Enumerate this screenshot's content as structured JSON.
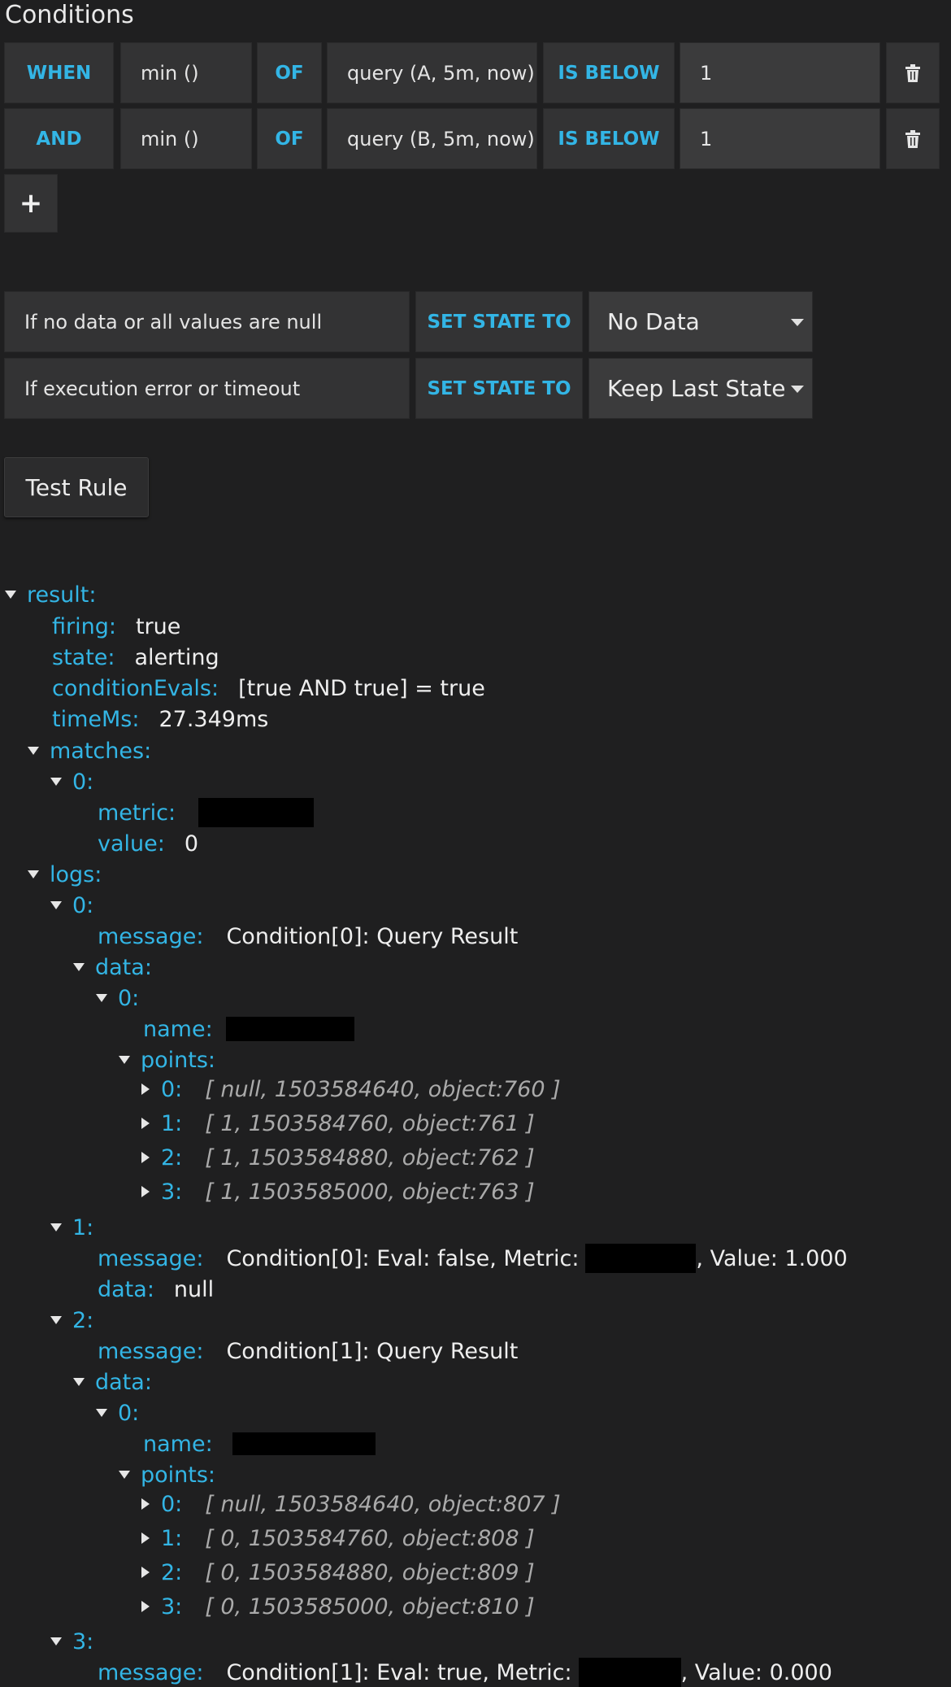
{
  "header": {
    "title": "Conditions"
  },
  "conditions": [
    {
      "type": "WHEN",
      "reducer": "min ()",
      "of": "OF",
      "query": "query (A, 5m, now)",
      "evaluator": "IS BELOW",
      "threshold": "1"
    },
    {
      "type": "AND",
      "reducer": "min ()",
      "of": "OF",
      "query": "query (B, 5m, now)",
      "evaluator": "IS BELOW",
      "threshold": "1"
    }
  ],
  "add_label": "+",
  "no_data": {
    "label": "If no data or all values are null",
    "action": "SET STATE TO",
    "selected": "No Data"
  },
  "exec_error": {
    "label": "If execution error or timeout",
    "action": "SET STATE TO",
    "selected": "Keep Last State"
  },
  "test_rule_label": "Test Rule",
  "result": {
    "key": "result:",
    "firing": {
      "key": "firing:",
      "value": "true"
    },
    "state": {
      "key": "state:",
      "value": "alerting"
    },
    "conditionEvals": {
      "key": "conditionEvals:",
      "value": "[true AND true] = true"
    },
    "timeMs": {
      "key": "timeMs:",
      "value": "27.349ms"
    },
    "matches": {
      "key": "matches:",
      "item0": {
        "key": "0:",
        "metric_key": "metric:",
        "value_key": "value:",
        "value": "0"
      }
    },
    "logs": {
      "key": "logs:",
      "log0": {
        "key": "0:",
        "message_key": "message:",
        "message": "Condition[0]: Query Result",
        "data_key": "data:",
        "d0": "0:",
        "name_key": "name:",
        "points_key": "points:",
        "points": [
          {
            "k": "0:",
            "v": "[ null, 1503584640, object:760 ]"
          },
          {
            "k": "1:",
            "v": "[ 1, 1503584760, object:761 ]"
          },
          {
            "k": "2:",
            "v": "[ 1, 1503584880, object:762 ]"
          },
          {
            "k": "3:",
            "v": "[ 1, 1503585000, object:763 ]"
          }
        ]
      },
      "log1": {
        "key": "1:",
        "message_key": "message:",
        "message_pre": "Condition[0]: Eval: false, Metric:",
        "message_post": ", Value: 1.000",
        "data_key": "data:",
        "data_value": "null"
      },
      "log2": {
        "key": "2:",
        "message_key": "message:",
        "message": "Condition[1]: Query Result",
        "data_key": "data:",
        "d0": "0:",
        "name_key": "name:",
        "points_key": "points:",
        "points": [
          {
            "k": "0:",
            "v": "[ null, 1503584640, object:807 ]"
          },
          {
            "k": "1:",
            "v": "[ 0, 1503584760, object:808 ]"
          },
          {
            "k": "2:",
            "v": "[ 0, 1503584880, object:809 ]"
          },
          {
            "k": "3:",
            "v": "[ 0, 1503585000, object:810 ]"
          }
        ]
      },
      "log3": {
        "key": "3:",
        "message_key": "message:",
        "message_pre": "Condition[1]: Eval: true, Metric:",
        "message_post": ", Value: 0.000"
      }
    }
  }
}
